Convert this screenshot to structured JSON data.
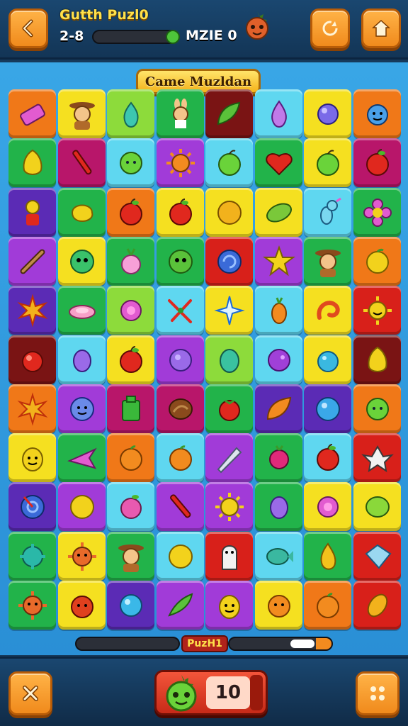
{
  "header": {
    "title": "Gutth Puzl0",
    "level": "2-8",
    "level_progress": 0.9,
    "maze_label": "MZIE 0"
  },
  "board": {
    "banner": "Came Muzldan",
    "rows": [
      [
        [
          "#f07818",
          "eraser"
        ],
        [
          "#f5e020",
          "cowboy"
        ],
        [
          "#8ddb3b",
          "pear"
        ],
        [
          "#22b34a",
          "bunny"
        ],
        [
          "#7a1414",
          "leaf"
        ],
        [
          "#5fd7f0",
          "drop"
        ],
        [
          "#f5e020",
          "bubble"
        ],
        [
          "#f07818",
          "blob"
        ]
      ],
      [
        [
          "#22b34a",
          "lemon"
        ],
        [
          "#b8166a",
          "brush"
        ],
        [
          "#5fd7f0",
          "lime"
        ],
        [
          "#a13bd8",
          "sun"
        ],
        [
          "#5fd7f0",
          "apple-green"
        ],
        [
          "#22b34a",
          "heart"
        ],
        [
          "#f5e020",
          "apple-green"
        ],
        [
          "#b8166a",
          "apple-red"
        ]
      ],
      [
        [
          "#5b2bb5",
          "robot"
        ],
        [
          "#22b34a",
          "blob-yellow"
        ],
        [
          "#f07818",
          "apple-red"
        ],
        [
          "#f5e020",
          "apple-red"
        ],
        [
          "#f5e020",
          "orb"
        ],
        [
          "#f5e020",
          "bean"
        ],
        [
          "#5fd7f0",
          "unicorn"
        ],
        [
          "#22b34a",
          "flower"
        ]
      ],
      [
        [
          "#a13bd8",
          "brush2"
        ],
        [
          "#f5e020",
          "monster"
        ],
        [
          "#22b34a",
          "radish"
        ],
        [
          "#22b34a",
          "monster-green"
        ],
        [
          "#d8201a",
          "spiral"
        ],
        [
          "#a13bd8",
          "star"
        ],
        [
          "#22b34a",
          "cowboy"
        ],
        [
          "#f07818",
          "lemon-round"
        ]
      ],
      [
        [
          "#5b2bb5",
          "burst"
        ],
        [
          "#22b34a",
          "ring"
        ],
        [
          "#8ddb3b",
          "flower-pink"
        ],
        [
          "#5fd7f0",
          "sparkle"
        ],
        [
          "#f5e020",
          "comet"
        ],
        [
          "#5fd7f0",
          "carrot"
        ],
        [
          "#f5e020",
          "swirl"
        ],
        [
          "#d8201a",
          "sun-smile"
        ]
      ],
      [
        [
          "#7a1414",
          "cherry"
        ],
        [
          "#5fd7f0",
          "plum"
        ],
        [
          "#f5e020",
          "apple-red"
        ],
        [
          "#a13bd8",
          "grape"
        ],
        [
          "#8ddb3b",
          "egg"
        ],
        [
          "#5fd7f0",
          "grape2"
        ],
        [
          "#f5e020",
          "drop-blue"
        ],
        [
          "#7a1414",
          "lemon"
        ]
      ],
      [
        [
          "#f07818",
          "burst"
        ],
        [
          "#a13bd8",
          "face-blue"
        ],
        [
          "#b8166a",
          "box"
        ],
        [
          "#b8166a",
          "nut"
        ],
        [
          "#22b34a",
          "tomato"
        ],
        [
          "#5b2bb5",
          "leaf-orange"
        ],
        [
          "#5b2bb5",
          "orb-blue"
        ],
        [
          "#f07818",
          "lime"
        ]
      ],
      [
        [
          "#f5e020",
          "face-yellow"
        ],
        [
          "#22b34a",
          "plane"
        ],
        [
          "#f07818",
          "orange"
        ],
        [
          "#5fd7f0",
          "orange"
        ],
        [
          "#a13bd8",
          "rocket"
        ],
        [
          "#22b34a",
          "berry"
        ],
        [
          "#5fd7f0",
          "apple-red"
        ],
        [
          "#d8201a",
          "gremlin"
        ]
      ],
      [
        [
          "#5b2bb5",
          "whirl"
        ],
        [
          "#a13bd8",
          "coin"
        ],
        [
          "#5fd7f0",
          "peach"
        ],
        [
          "#a13bd8",
          "pen"
        ],
        [
          "#a13bd8",
          "sun-face"
        ],
        [
          "#22b34a",
          "plum"
        ],
        [
          "#f5e020",
          "flower-pink"
        ],
        [
          "#f5e020",
          "lime-big"
        ]
      ],
      [
        [
          "#22b34a",
          "blob-teal"
        ],
        [
          "#f5e020",
          "sun-orange"
        ],
        [
          "#22b34a",
          "cowboy"
        ],
        [
          "#5fd7f0",
          "coin"
        ],
        [
          "#d8201a",
          "ghost"
        ],
        [
          "#5fd7f0",
          "fish"
        ],
        [
          "#22b34a",
          "pear-yellow"
        ],
        [
          "#d8201a",
          "gem"
        ]
      ],
      [
        [
          "#22b34a",
          "sun-orange"
        ],
        [
          "#f5e020",
          "tomato-face"
        ],
        [
          "#5b2bb5",
          "orb-cyan"
        ],
        [
          "#a13bd8",
          "chili"
        ],
        [
          "#a13bd8",
          "face-yellow"
        ],
        [
          "#f5e020",
          "orange-face"
        ],
        [
          "#f07818",
          "orange"
        ],
        [
          "#d8201a",
          "mango"
        ]
      ]
    ]
  },
  "footer": {
    "progress_label": "PuzH1",
    "moves": "10",
    "move_progress": 0.25
  },
  "icons": {
    "back": "chevron-left-icon",
    "refresh": "refresh-icon",
    "home": "home-icon",
    "close": "close-icon",
    "menu": "dots-icon"
  }
}
